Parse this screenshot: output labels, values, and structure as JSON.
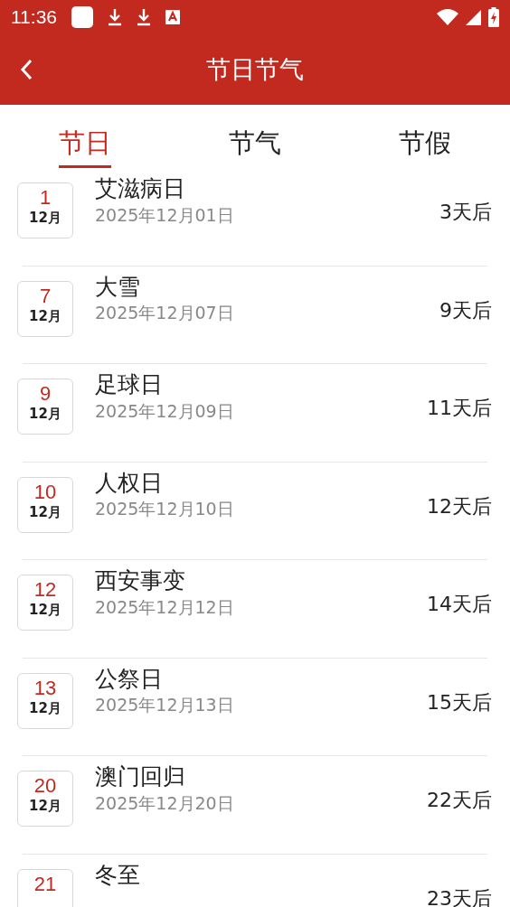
{
  "status_bar": {
    "time": "11:36"
  },
  "header": {
    "title": "节日节气"
  },
  "tabs": [
    {
      "label": "节日",
      "selected": true
    },
    {
      "label": "节气",
      "selected": false
    },
    {
      "label": "节假",
      "selected": false
    }
  ],
  "festivals": [
    {
      "day": "1",
      "month": "12月",
      "name": "艾滋病日",
      "date": "2025年12月01日",
      "countdown": "3天后"
    },
    {
      "day": "7",
      "month": "12月",
      "name": "大雪",
      "date": "2025年12月07日",
      "countdown": "9天后"
    },
    {
      "day": "9",
      "month": "12月",
      "name": "足球日",
      "date": "2025年12月09日",
      "countdown": "11天后"
    },
    {
      "day": "10",
      "month": "12月",
      "name": "人权日",
      "date": "2025年12月10日",
      "countdown": "12天后"
    },
    {
      "day": "12",
      "month": "12月",
      "name": "西安事变",
      "date": "2025年12月12日",
      "countdown": "14天后"
    },
    {
      "day": "13",
      "month": "12月",
      "name": "公祭日",
      "date": "2025年12月13日",
      "countdown": "15天后"
    },
    {
      "day": "20",
      "month": "12月",
      "name": "澳门回归",
      "date": "2025年12月20日",
      "countdown": "22天后"
    },
    {
      "day": "21",
      "name": "冬至",
      "countdown": "23天后"
    }
  ]
}
